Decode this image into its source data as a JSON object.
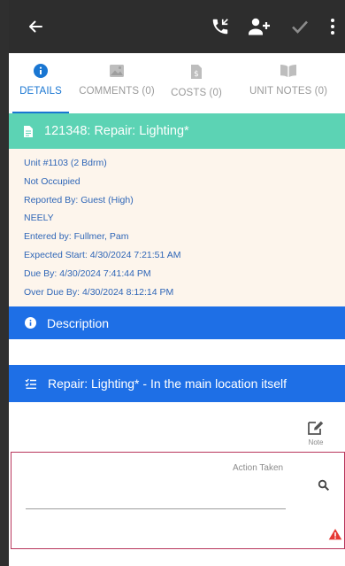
{
  "toolbar": {
    "back_icon": "arrow-left-icon",
    "call_icon": "phone-callback-icon",
    "add_user_icon": "person-add-icon",
    "check_icon": "check-icon",
    "more_icon": "more-vertical-icon"
  },
  "tabs": [
    {
      "label": "DETAILS",
      "icon": "info-circle-icon",
      "active": true
    },
    {
      "label": "COMMENTS (0)",
      "icon": "image-icon",
      "active": false
    },
    {
      "label": "COSTS (0)",
      "icon": "dollar-document-icon",
      "active": false
    },
    {
      "label": "UNIT NOTES (0)",
      "icon": "book-open-icon",
      "active": false
    }
  ],
  "work_order": {
    "title": "121348: Repair: Lighting*",
    "icon": "document-icon"
  },
  "details": {
    "unit": "Unit #1103 (2 Bdrm)",
    "occupancy": "Not Occupied",
    "reported_by": "Reported By: Guest  (High)",
    "tech": "NEELY",
    "entered_by": "Entered by: Fullmer, Pam",
    "expected_start": "Expected Start: 4/30/2024 7:21:51 AM",
    "due_by": "Due By: 4/30/2024 7:41:44 PM",
    "over_due_by": "Over Due By: 4/30/2024 8:12:14 PM"
  },
  "description": {
    "title": "Description",
    "icon": "info-circle-icon"
  },
  "task": {
    "title": "Repair: Lighting* - In the main location itself",
    "icon": "checklist-icon"
  },
  "note_button": {
    "label": "Note",
    "icon": "edit-note-icon"
  },
  "action_taken": {
    "label": "Action Taken",
    "value": "",
    "placeholder": "",
    "search_icon": "search-icon",
    "warning_icon": "warning-icon"
  },
  "colors": {
    "toolbar": "#2d2d2d",
    "accent_blue": "#1976d2",
    "teal_header": "#5cd3b4",
    "section_blue": "#1e6fe6",
    "info_bg": "#fdf5ec",
    "info_text": "#2f66b7",
    "error_border": "#b8365c",
    "warning_red": "#e53935"
  }
}
